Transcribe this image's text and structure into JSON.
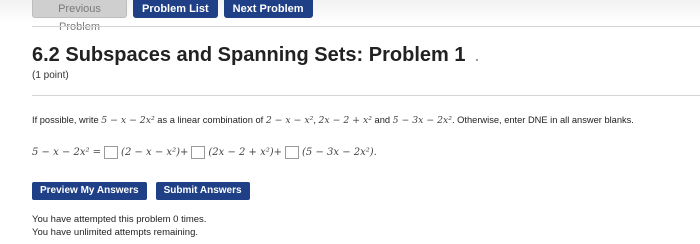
{
  "nav": {
    "previous_label": "Previous Problem",
    "list_label": "Problem List",
    "next_label": "Next Problem"
  },
  "problem": {
    "title": "6.2 Subspaces and Spanning Sets: Problem 1",
    "title_dot": ".",
    "points": "(1 point)",
    "prompt_prefix": "If possible, write ",
    "target_vector": "5 − x − 2x²",
    "prompt_middle": " as a linear combination of ",
    "vec1": "2 − x − x²",
    "comma": ", ",
    "vec2": "2x − 2 + x²",
    "and_text": " and ",
    "vec3": "5 − 3x − 2x²",
    "prompt_suffix": ". Otherwise, enter DNE in all answer blanks."
  },
  "equation": {
    "lhs": "5 − x − 2x² =",
    "term1": "(2 − x − x²)+",
    "term2": "(2x − 2 + x²)+",
    "term3": "(5 − 3x − 2x²)."
  },
  "buttons": {
    "preview_label": "Preview My Answers",
    "submit_label": "Submit Answers"
  },
  "status": {
    "attempts_text": "You have attempted this problem 0 times.",
    "remaining_text": "You have unlimited attempts remaining."
  },
  "colors": {
    "accent": "#1f3f86",
    "disabled": "#cfcfcf"
  }
}
